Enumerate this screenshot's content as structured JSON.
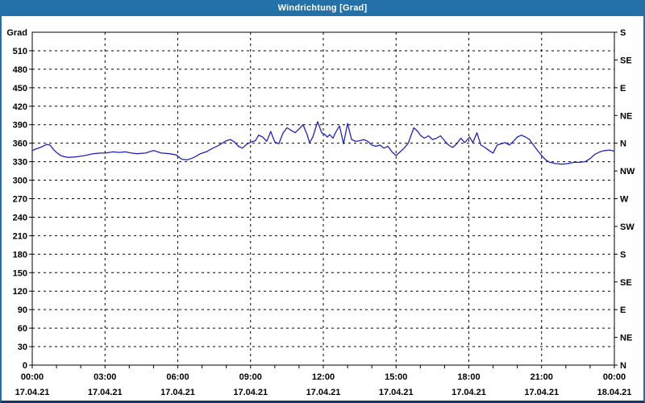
{
  "window": {
    "title": "Windrichtung [Grad]"
  },
  "colors": {
    "titlebar_bg": "#2470a8",
    "titlebar_text": "#ffffff",
    "border_side": "#2470a8",
    "border_bottom": "#17375d",
    "plot_frame": "#000000",
    "gridline": "#000000",
    "tick_text": "#000000",
    "line": "#2222bb",
    "background": "#ffffff"
  },
  "axes": {
    "left": {
      "label": "Grad",
      "ticks": [
        0,
        30,
        60,
        90,
        120,
        150,
        180,
        210,
        240,
        270,
        300,
        330,
        360,
        390,
        420,
        450,
        480,
        510
      ]
    },
    "right": {
      "ticks": [
        {
          "deg": 0,
          "label": "N"
        },
        {
          "deg": 45,
          "label": "NE"
        },
        {
          "deg": 90,
          "label": "E"
        },
        {
          "deg": 135,
          "label": "SE"
        },
        {
          "deg": 180,
          "label": "S"
        },
        {
          "deg": 225,
          "label": "SW"
        },
        {
          "deg": 270,
          "label": "W"
        },
        {
          "deg": 315,
          "label": "NW"
        },
        {
          "deg": 360,
          "label": "N"
        },
        {
          "deg": 405,
          "label": "NE"
        },
        {
          "deg": 450,
          "label": "E"
        },
        {
          "deg": 495,
          "label": "SE"
        },
        {
          "deg": 540,
          "label": "S"
        }
      ]
    },
    "bottom": {
      "ticks": [
        {
          "time": "00:00",
          "date": "17.04.21"
        },
        {
          "time": "03:00",
          "date": "17.04.21"
        },
        {
          "time": "06:00",
          "date": "17.04.21"
        },
        {
          "time": "09:00",
          "date": "17.04.21"
        },
        {
          "time": "12:00",
          "date": "17.04.21"
        },
        {
          "time": "15:00",
          "date": "17.04.21"
        },
        {
          "time": "18:00",
          "date": "17.04.21"
        },
        {
          "time": "21:00",
          "date": "17.04.21"
        },
        {
          "time": "00:00",
          "date": "18.04.21"
        }
      ]
    }
  },
  "chart_data": {
    "type": "line",
    "title": "Windrichtung [Grad]",
    "xlabel": "",
    "ylabel": "Grad",
    "ylim": [
      0,
      540
    ],
    "x_unit": "minutes_since_00:00_17.04.21",
    "x_max": 1440,
    "x_major_tick_interval_min": 180,
    "x_minor_tick_interval_min": 60,
    "grid": true,
    "legend": "none",
    "series": [
      {
        "name": "Windrichtung",
        "color": "#2222bb",
        "points": [
          [
            0,
            348
          ],
          [
            10,
            351
          ],
          [
            20,
            353
          ],
          [
            36,
            358
          ],
          [
            44,
            357
          ],
          [
            52,
            350
          ],
          [
            60,
            345
          ],
          [
            70,
            340
          ],
          [
            80,
            338
          ],
          [
            90,
            337
          ],
          [
            110,
            338
          ],
          [
            130,
            340
          ],
          [
            150,
            343
          ],
          [
            170,
            344
          ],
          [
            180,
            344
          ],
          [
            200,
            346
          ],
          [
            215,
            345
          ],
          [
            230,
            346
          ],
          [
            245,
            344
          ],
          [
            260,
            343
          ],
          [
            280,
            344
          ],
          [
            300,
            348
          ],
          [
            310,
            346
          ],
          [
            320,
            344
          ],
          [
            340,
            343
          ],
          [
            356,
            341
          ],
          [
            370,
            334
          ],
          [
            384,
            333
          ],
          [
            400,
            337
          ],
          [
            416,
            343
          ],
          [
            430,
            346
          ],
          [
            444,
            351
          ],
          [
            460,
            356
          ],
          [
            470,
            360
          ],
          [
            480,
            364
          ],
          [
            490,
            366
          ],
          [
            500,
            362
          ],
          [
            510,
            355
          ],
          [
            520,
            352
          ],
          [
            530,
            358
          ],
          [
            542,
            362
          ],
          [
            552,
            364
          ],
          [
            560,
            373
          ],
          [
            570,
            370
          ],
          [
            580,
            363
          ],
          [
            590,
            379
          ],
          [
            600,
            362
          ],
          [
            610,
            359
          ],
          [
            620,
            376
          ],
          [
            630,
            385
          ],
          [
            640,
            381
          ],
          [
            650,
            377
          ],
          [
            660,
            383
          ],
          [
            670,
            390
          ],
          [
            680,
            374
          ],
          [
            686,
            361
          ],
          [
            694,
            370
          ],
          [
            706,
            395
          ],
          [
            716,
            377
          ],
          [
            724,
            374
          ],
          [
            730,
            370
          ],
          [
            736,
            374
          ],
          [
            744,
            368
          ],
          [
            750,
            377
          ],
          [
            760,
            388
          ],
          [
            770,
            359
          ],
          [
            780,
            392
          ],
          [
            790,
            366
          ],
          [
            800,
            363
          ],
          [
            810,
            364
          ],
          [
            820,
            366
          ],
          [
            830,
            363
          ],
          [
            840,
            357
          ],
          [
            850,
            355
          ],
          [
            860,
            357
          ],
          [
            870,
            352
          ],
          [
            880,
            355
          ],
          [
            890,
            346
          ],
          [
            900,
            340
          ],
          [
            910,
            346
          ],
          [
            920,
            352
          ],
          [
            930,
            360
          ],
          [
            944,
            385
          ],
          [
            954,
            379
          ],
          [
            960,
            373
          ],
          [
            970,
            368
          ],
          [
            980,
            372
          ],
          [
            990,
            366
          ],
          [
            1000,
            368
          ],
          [
            1010,
            372
          ],
          [
            1020,
            364
          ],
          [
            1030,
            357
          ],
          [
            1040,
            353
          ],
          [
            1050,
            359
          ],
          [
            1060,
            368
          ],
          [
            1070,
            361
          ],
          [
            1082,
            370
          ],
          [
            1090,
            361
          ],
          [
            1100,
            377
          ],
          [
            1110,
            357
          ],
          [
            1120,
            353
          ],
          [
            1130,
            348
          ],
          [
            1140,
            344
          ],
          [
            1150,
            357
          ],
          [
            1160,
            359
          ],
          [
            1170,
            361
          ],
          [
            1180,
            357
          ],
          [
            1190,
            363
          ],
          [
            1200,
            370
          ],
          [
            1210,
            373
          ],
          [
            1220,
            370
          ],
          [
            1230,
            366
          ],
          [
            1240,
            357
          ],
          [
            1250,
            348
          ],
          [
            1260,
            340
          ],
          [
            1270,
            333
          ],
          [
            1280,
            329
          ],
          [
            1294,
            327
          ],
          [
            1310,
            326
          ],
          [
            1326,
            327
          ],
          [
            1340,
            329
          ],
          [
            1354,
            329
          ],
          [
            1368,
            330
          ],
          [
            1380,
            335
          ],
          [
            1392,
            342
          ],
          [
            1404,
            346
          ],
          [
            1416,
            348
          ],
          [
            1428,
            349
          ],
          [
            1440,
            347
          ]
        ]
      }
    ]
  }
}
